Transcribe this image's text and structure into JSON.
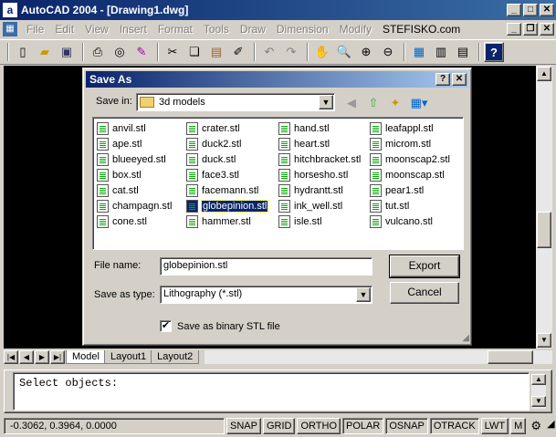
{
  "app": {
    "title": "AutoCAD 2004 - [Drawing1.dwg]"
  },
  "menu": [
    "File",
    "Edit",
    "View",
    "Insert",
    "Format",
    "Tools",
    "Draw",
    "Dimension",
    "Modify",
    "STEFISKO.com"
  ],
  "tabs": [
    "Model",
    "Layout1",
    "Layout2"
  ],
  "command": {
    "text": "Select objects:"
  },
  "status": {
    "coords": "-0.3062, 0.3964, 0.0000",
    "toggles": [
      "SNAP",
      "GRID",
      "ORTHO",
      "POLAR",
      "OSNAP",
      "OTRACK",
      "LWT",
      "M"
    ]
  },
  "dialog": {
    "title": "Save As",
    "save_in_label": "Save in:",
    "save_in_value": "3d models",
    "files": [
      [
        "anvil.stl",
        "ape.stl",
        "blueeyed.stl",
        "box.stl",
        "cat.stl",
        "champagn.stl",
        "cone.stl"
      ],
      [
        "crater.stl",
        "duck2.stl",
        "duck.stl",
        "face3.stl",
        "facemann.stl",
        "globepinion.stl",
        "hammer.stl"
      ],
      [
        "hand.stl",
        "heart.stl",
        "hitchbracket.stl",
        "horsesho.stl",
        "hydrantt.stl",
        "ink_well.stl",
        "isle.stl"
      ],
      [
        "leafappl.stl",
        "microm.stl",
        "moonscap2.stl",
        "moonscap.stl",
        "pear1.stl",
        "tut.stl",
        "vulcano.stl"
      ]
    ],
    "selected_file": "globepinion.stl",
    "file_name_label": "File name:",
    "file_name_value": "globepinion.stl",
    "save_type_label": "Save as type:",
    "save_type_value": "Lithography (*.stl)",
    "export_label": "Export",
    "cancel_label": "Cancel",
    "binary_label": "Save as binary STL file",
    "binary_checked": true
  }
}
